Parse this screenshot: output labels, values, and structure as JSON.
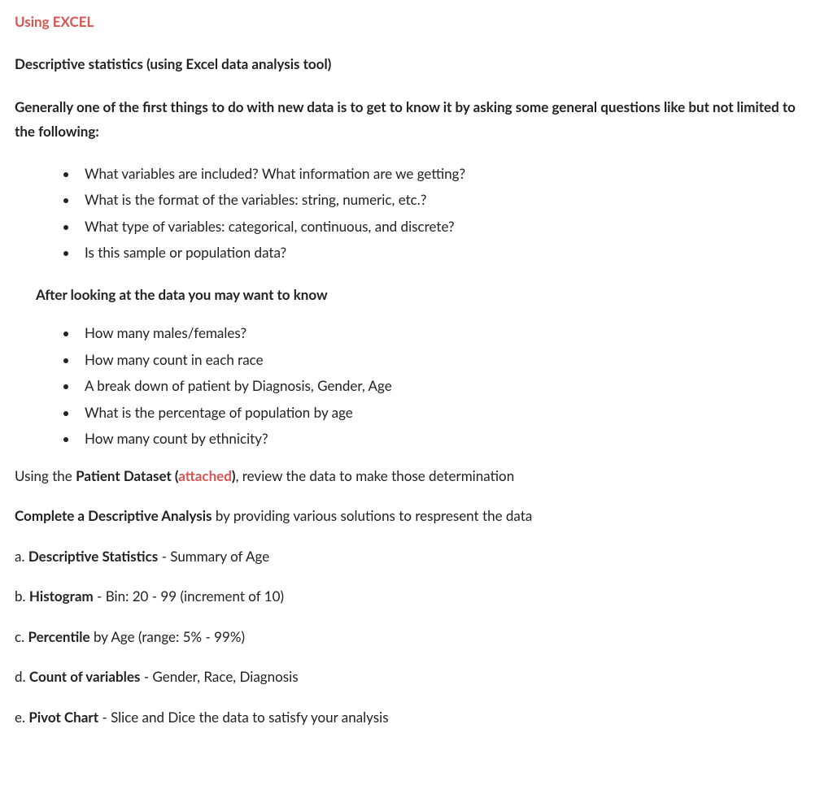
{
  "title": "Using EXCEL",
  "subtitle": "Descriptive statistics (using Excel data analysis tool)",
  "intro": "Generally one of the first things to do with new data is to get to know it by asking some general questions like but not limited to the following:",
  "list1": {
    "items": [
      "What variables are included? What information are we getting?",
      "What is the format of the variables: string, numeric, etc.?",
      "What type of variables: categorical, continuous, and discrete?",
      "Is this sample or population data?"
    ]
  },
  "afterHeading": "After looking at the data you may want to know",
  "list2": {
    "items": [
      "How many males/females?",
      "How many count in each race",
      "A break down of patient by Diagnosis, Gender, Age",
      "What is the percentage of population by age",
      "How many count by ethnicity?"
    ]
  },
  "usingLine": {
    "prefix": "Using the ",
    "boldPart": "Patient Dataset (",
    "attached": "attached",
    "boldClose": ")",
    "suffix": ", review the data to make those determination"
  },
  "completeLine": {
    "bold": "Complete a Descriptive Analysis",
    "rest": " by providing various solutions to respresent the data"
  },
  "tasks": {
    "a": {
      "prefix": "a. ",
      "bold": "Descriptive Statistics",
      "rest": " - Summary of Age"
    },
    "b": {
      "prefix": "b. ",
      "bold": "Histogram",
      "rest": " - Bin: 20 - 99 (increment of 10)"
    },
    "c": {
      "prefix": "c. ",
      "bold": "Percentile",
      "rest": " by Age (range: 5% - 99%)"
    },
    "d": {
      "prefix": "d. ",
      "bold": "Count of variables",
      "rest": " - Gender, Race, Diagnosis"
    },
    "e": {
      "prefix": "e. ",
      "bold": "Pivot Chart",
      "rest": " - Slice and Dice the data to satisfy your analysis"
    }
  }
}
